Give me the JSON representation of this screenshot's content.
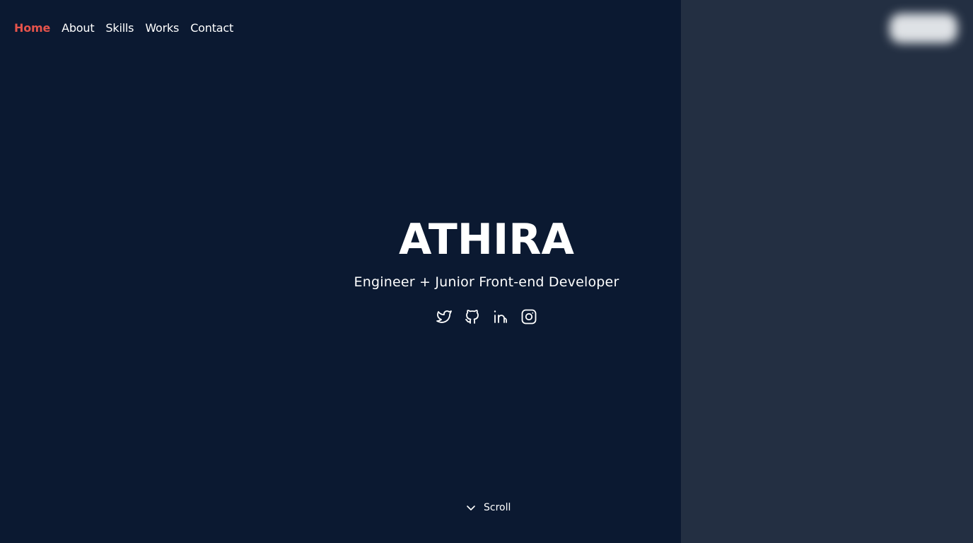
{
  "nav": {
    "items": [
      {
        "label": "Home",
        "active": true
      },
      {
        "label": "About",
        "active": false
      },
      {
        "label": "Skills",
        "active": false
      },
      {
        "label": "Works",
        "active": false
      },
      {
        "label": "Contact",
        "active": false
      }
    ]
  },
  "hero": {
    "name": "ATHIRA",
    "tagline": "Engineer + Junior Front-end Developer"
  },
  "socials": [
    {
      "icon": "twitter-icon"
    },
    {
      "icon": "github-icon"
    },
    {
      "icon": "linkedin-icon"
    },
    {
      "icon": "instagram-icon"
    }
  ],
  "scroll": {
    "label": "Scroll"
  },
  "colors": {
    "background": "#0b1931",
    "side_panel": "#232f42",
    "accent": "#e5534b",
    "text": "#ffffff"
  }
}
